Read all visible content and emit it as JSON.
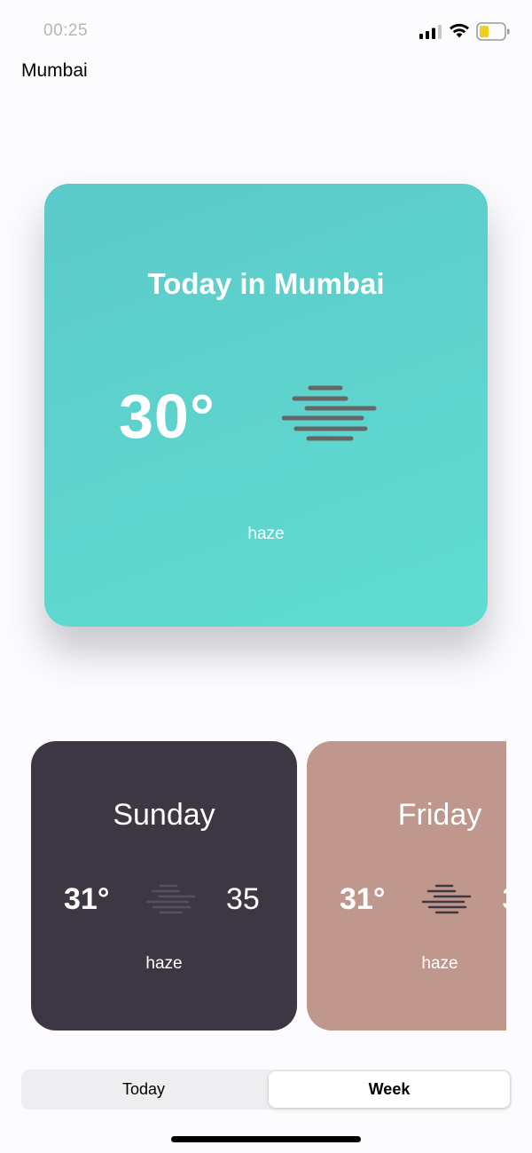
{
  "status": {
    "time": "00:25"
  },
  "header": {
    "city": "Mumbai"
  },
  "today": {
    "heading": "Today in Mumbai",
    "temperature": "30°",
    "condition": "haze",
    "icon": "haze-icon",
    "color": "#5fd3cd"
  },
  "forecast": [
    {
      "day": "Sunday",
      "temp": "31°",
      "high": "35",
      "condition": "haze",
      "icon": "haze-icon",
      "color": "#3d3643"
    },
    {
      "day": "Friday",
      "temp": "31°",
      "high": "3",
      "condition": "haze",
      "icon": "haze-icon",
      "color": "#bf978c"
    }
  ],
  "tabs": {
    "today_label": "Today",
    "week_label": "Week",
    "selected": "Week"
  },
  "colors": {
    "accent_card": "#5fd3cd",
    "dark_card": "#3d3643",
    "rose_card": "#bf978c"
  }
}
